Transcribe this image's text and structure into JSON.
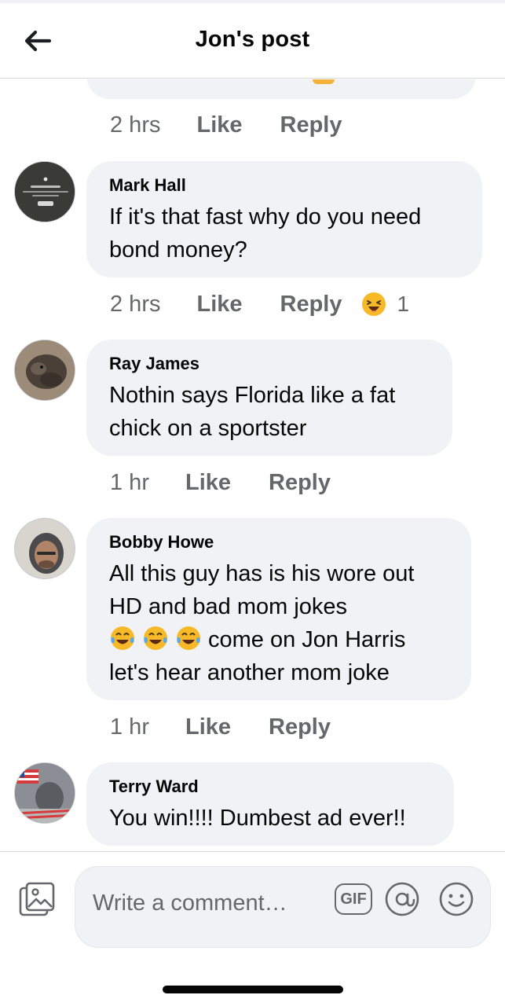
{
  "header": {
    "title": "Jon's post",
    "back_icon": "arrow-left-icon"
  },
  "previous_comment": {
    "time": "2 hrs",
    "like_label": "Like",
    "reply_label": "Reply"
  },
  "comments": [
    {
      "name": "Mark Hall",
      "text": "If it's that fast why do you need bond money?",
      "time": "2 hrs",
      "like_label": "Like",
      "reply_label": "Reply",
      "reaction": {
        "icon": "laughing-emoji-icon",
        "count": "1"
      }
    },
    {
      "name": "Ray James",
      "text": "Nothin says Florida like a fat chick on a sportster",
      "time": "1 hr",
      "like_label": "Like",
      "reply_label": "Reply"
    },
    {
      "name": "Bobby Howe",
      "text_line1": "All this guy has is his wore out",
      "text_line2": "HD and bad mom jokes",
      "text_line3": "come on Jon Harris",
      "text_line4": "let's hear another mom joke",
      "emojis": [
        "tears-of-joy-emoji-icon",
        "tears-of-joy-emoji-icon",
        "tears-of-joy-emoji-icon"
      ],
      "time": "1 hr",
      "like_label": "Like",
      "reply_label": "Reply"
    },
    {
      "name": "Terry Ward",
      "text": "You win!!!! Dumbest ad ever!!"
    }
  ],
  "composer": {
    "placeholder": "Write a comment…",
    "gif_label": "GIF",
    "photo_icon": "photo-icon",
    "mention_icon": "at-sign-icon",
    "emoji_icon": "smiley-icon"
  },
  "colors": {
    "bubble": "#f0f2f5",
    "meta_text": "#65676b",
    "text": "#050505"
  }
}
